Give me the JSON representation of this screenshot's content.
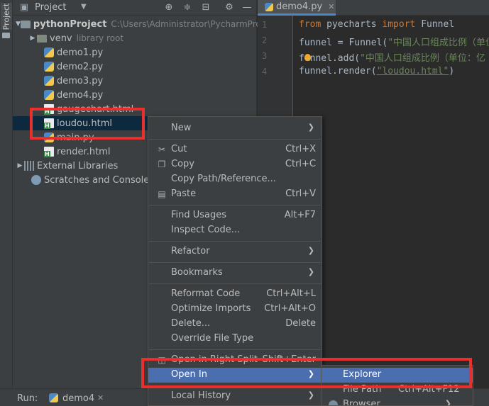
{
  "toolstrip": {
    "label": "Project"
  },
  "project_panel": {
    "title": "Project",
    "tree": {
      "root_label": "pythonProject",
      "root_path": "C:\\Users\\Administrator\\PycharmProj",
      "venv_label": "venv",
      "venv_hint": "library root",
      "files": [
        "demo1.py",
        "demo2.py",
        "demo3.py",
        "demo4.py",
        "gaugechart.html",
        "loudou.html",
        "main.py",
        "render.html"
      ],
      "external_libraries": "External Libraries",
      "scratches": "Scratches and Consoles"
    }
  },
  "editor": {
    "tab_label": "demo4.py",
    "line_numbers": [
      "1",
      "2",
      "3",
      "4"
    ],
    "code": {
      "l1_kw1": "from",
      "l1_mod": " pyecharts ",
      "l1_kw2": "import",
      "l1_name": " Funnel",
      "l2_prefix": "funnel = Funnel(",
      "l2_str": "\"中国人口组成比例（单位",
      "l3_prefix": "funnel.add(",
      "l3_str": "\"中国人口组成比例（单位：亿",
      "l4_prefix": "funnel.render(",
      "l4_str": "\"loudou.html\"",
      "l4_suffix": ")"
    }
  },
  "context_menu": {
    "new": "New",
    "cut": "Cut",
    "cut_sc": "Ctrl+X",
    "copy": "Copy",
    "copy_sc": "Ctrl+C",
    "copy_path": "Copy Path/Reference...",
    "paste": "Paste",
    "paste_sc": "Ctrl+V",
    "find_usages": "Find Usages",
    "find_usages_sc": "Alt+F7",
    "inspect_code": "Inspect Code...",
    "refactor": "Refactor",
    "bookmarks": "Bookmarks",
    "reformat": "Reformat Code",
    "reformat_sc": "Ctrl+Alt+L",
    "optimize": "Optimize Imports",
    "optimize_sc": "Ctrl+Alt+O",
    "delete": "Delete...",
    "delete_sc": "Delete",
    "override": "Override File Type",
    "open_right": "Open in Right Split",
    "open_right_sc": "Shift+Enter",
    "open_in": "Open In",
    "local_history": "Local History"
  },
  "submenu": {
    "explorer": "Explorer",
    "file_path": "File Path",
    "file_path_sc": "Ctrl+Alt+F12",
    "browser": "Browser"
  },
  "runbar": {
    "label": "Run:",
    "tab": "demo4"
  },
  "colors": {
    "highlight": "#4b6eaf",
    "annotation": "#e8302f",
    "selection": "#0d293e"
  }
}
